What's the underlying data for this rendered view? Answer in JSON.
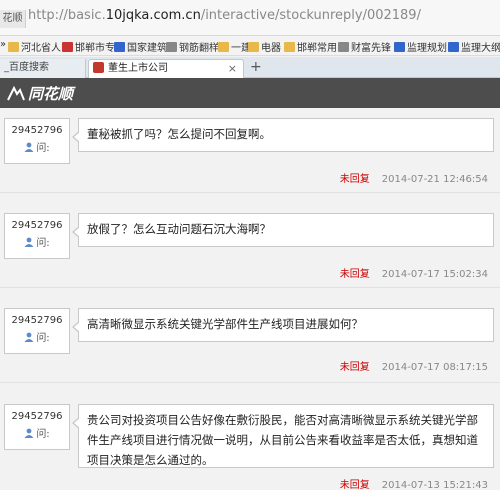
{
  "browser": {
    "brand_label": "花顺",
    "url_prefix": "http://basic.",
    "url_domain": "10jqka.com.cn",
    "url_path": "/interactive/stockunreply/002189/",
    "bookmarks": [
      {
        "label": "河北省人",
        "icon": "folder-icon",
        "color": "#e8b84a"
      },
      {
        "label": "邯郸市专",
        "icon": "site-icon",
        "color": "#cc3333"
      },
      {
        "label": "国家建筑",
        "icon": "site-icon",
        "color": "#3366cc"
      },
      {
        "label": "钢筋翻样",
        "icon": "page-icon",
        "color": "#888888"
      },
      {
        "label": "一建",
        "icon": "folder-icon",
        "color": "#e8b84a"
      },
      {
        "label": "电器",
        "icon": "folder-icon",
        "color": "#e8b84a"
      },
      {
        "label": "邯郸常用",
        "icon": "folder-icon",
        "color": "#e8b84a"
      },
      {
        "label": "财富先锋",
        "icon": "page-icon",
        "color": "#888888"
      },
      {
        "label": "监理规划",
        "icon": "site-icon",
        "color": "#3366cc"
      },
      {
        "label": "监理大纲",
        "icon": "site-icon",
        "color": "#3366cc"
      }
    ],
    "tabs": [
      {
        "label": "_百度搜索",
        "active": false
      },
      {
        "label": "董生上市公司",
        "active": true
      }
    ],
    "tab_close": "×",
    "new_tab": "+"
  },
  "site": {
    "logo_text": "同花顺"
  },
  "questions": [
    {
      "user_id": "29452796",
      "asked_label": "问:",
      "text": "董秘被抓了吗？怎么提问不回复啊。",
      "status": "未回复",
      "time": "2014-07-21 12:46:54"
    },
    {
      "user_id": "29452796",
      "asked_label": "问:",
      "text": "放假了？怎么互动问题石沉大海啊？",
      "status": "未回复",
      "time": "2014-07-17 15:02:34"
    },
    {
      "user_id": "29452796",
      "asked_label": "问:",
      "text": "高清晰微显示系统关键光学部件生产线项目进展如何？",
      "status": "未回复",
      "time": "2014-07-17 08:17:15"
    },
    {
      "user_id": "29452796",
      "asked_label": "问:",
      "text": "贵公司对投资项目公告好像在敷衍股民，能否对高清晰微显示系统关键光学部件生产线项目进行情况做一说明，从目前公告来看收益率是否太低，真想知道项目决策是怎么通过的。",
      "status": "未回复",
      "time": "2014-07-13 15:21:43"
    }
  ],
  "colors": {
    "header_bg": "#4d4d4d",
    "status_red": "#cc0000",
    "user_blue": "#5b8cc8"
  }
}
